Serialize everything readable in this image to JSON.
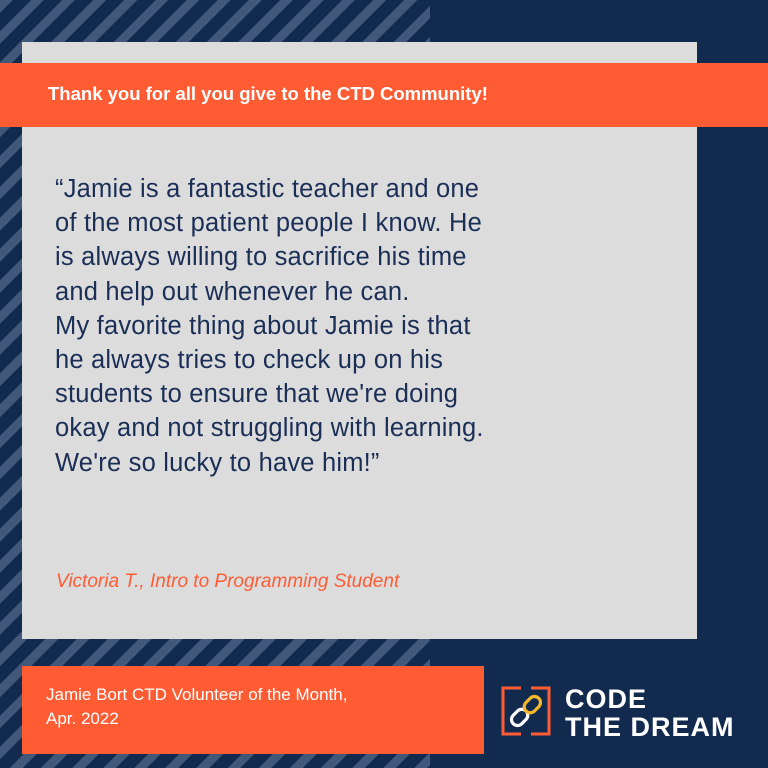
{
  "banner": {
    "text": "Thank you for all you give to the CTD Community!"
  },
  "quote": {
    "lines": [
      "“Jamie is a fantastic teacher and one",
      "of the most patient people I know. He",
      "is always willing to sacrifice his time",
      "and help out whenever he can.",
      "My favorite thing about Jamie is that",
      "he always tries to check up on his",
      "students to ensure that we're doing",
      "okay and not struggling with learning.",
      "We're so lucky to have him!”"
    ],
    "attribution": "Victoria T., Intro to Programming Student"
  },
  "footer": {
    "line1": "Jamie Bort CTD Volunteer of the Month,",
    "line2": "Apr. 2022"
  },
  "logo": {
    "icon": "chain-link-icon",
    "word1": "CODE",
    "word2": "THE DREAM"
  },
  "colors": {
    "navy": "#132a4f",
    "stripe": "#41587a",
    "orange": "#ff5c34",
    "card": "#dcdcdc",
    "quote_text": "#1a2e56",
    "logo_accent": "#f5b829"
  }
}
